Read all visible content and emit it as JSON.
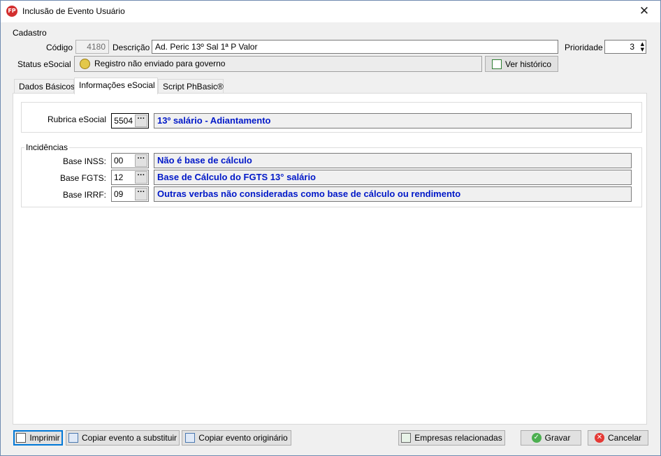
{
  "window": {
    "title": "Inclusão de Evento Usuário",
    "icon_text": "FP",
    "close_symbol": "✕"
  },
  "cadastro": {
    "legend": "Cadastro",
    "codigo_label": "Código",
    "codigo_value": "4180",
    "descricao_label": "Descrição",
    "descricao_value": "Ad. Peric 13º Sal 1ª P Valor",
    "prioridade_label": "Prioridade",
    "prioridade_value": "3",
    "status_label": "Status eSocial",
    "status_value": "Registro não enviado para governo",
    "ver_historico": "Ver histórico"
  },
  "tabs": [
    {
      "label": "Dados Básicos"
    },
    {
      "label": "Informações eSocial"
    },
    {
      "label": "Script PhBasic®"
    }
  ],
  "esocial": {
    "rubrica_label": "Rubrica eSocial",
    "rubrica_code": "5504",
    "rubrica_desc": "13º salário - Adiantamento",
    "incidencias_legend": "Incidências",
    "rows": [
      {
        "label": "Base INSS:",
        "code": "00",
        "desc": "Não é base de cálculo"
      },
      {
        "label": "Base FGTS:",
        "code": "12",
        "desc": "Base de Cálculo do FGTS 13° salário"
      },
      {
        "label": "Base IRRF:",
        "code": "09",
        "desc": "Outras verbas não consideradas como base de cálculo ou rendimento"
      }
    ],
    "ellipsis": "···"
  },
  "footer": {
    "imprimir": "Imprimir",
    "copiar_substituir": "Copiar evento a substituir",
    "copiar_originario": "Copiar evento originário",
    "empresas": "Empresas relacionadas",
    "gravar": "Gravar",
    "cancelar": "Cancelar"
  },
  "colors": {
    "accent": "#0078d7",
    "link_blue": "#0018c8",
    "ok_green": "#4caf50",
    "cancel_red": "#e53935"
  }
}
